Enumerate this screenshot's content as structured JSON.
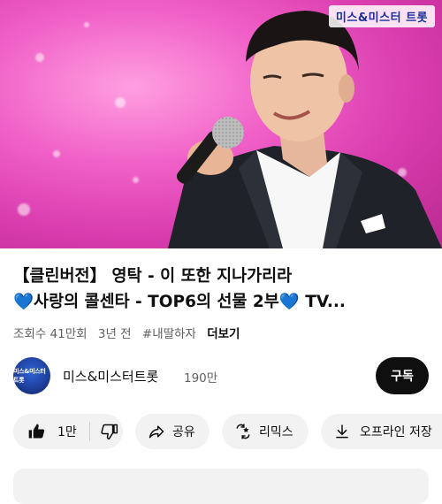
{
  "video": {
    "channel_watermark": "미스&미스터 트롯"
  },
  "title": {
    "line1": "【클린버전】 영탁 - 이 또한 지나가리라",
    "line2_text": "사랑의 콜센타 - TOP6의 선물 2부",
    "line2_tail": " TV...",
    "heart": "💙"
  },
  "meta": {
    "views": "조회수 41만회",
    "age": "3년 전",
    "hashtag": "#내딸하자",
    "more": "더보기"
  },
  "channel": {
    "avatar_text": "미스&미스터트롯",
    "name": "미스&미스터트롯",
    "subscribers": "190만",
    "subscribe_label": "구독"
  },
  "actions": {
    "like_count": "1만",
    "share_label": "공유",
    "remix_label": "리믹스",
    "download_label": "오프라인 저장"
  },
  "colors": {
    "accent_dark": "#0f0f0f",
    "chip_bg": "#f2f2f2",
    "secondary_text": "#606060",
    "heart": "#2aa8ee"
  }
}
